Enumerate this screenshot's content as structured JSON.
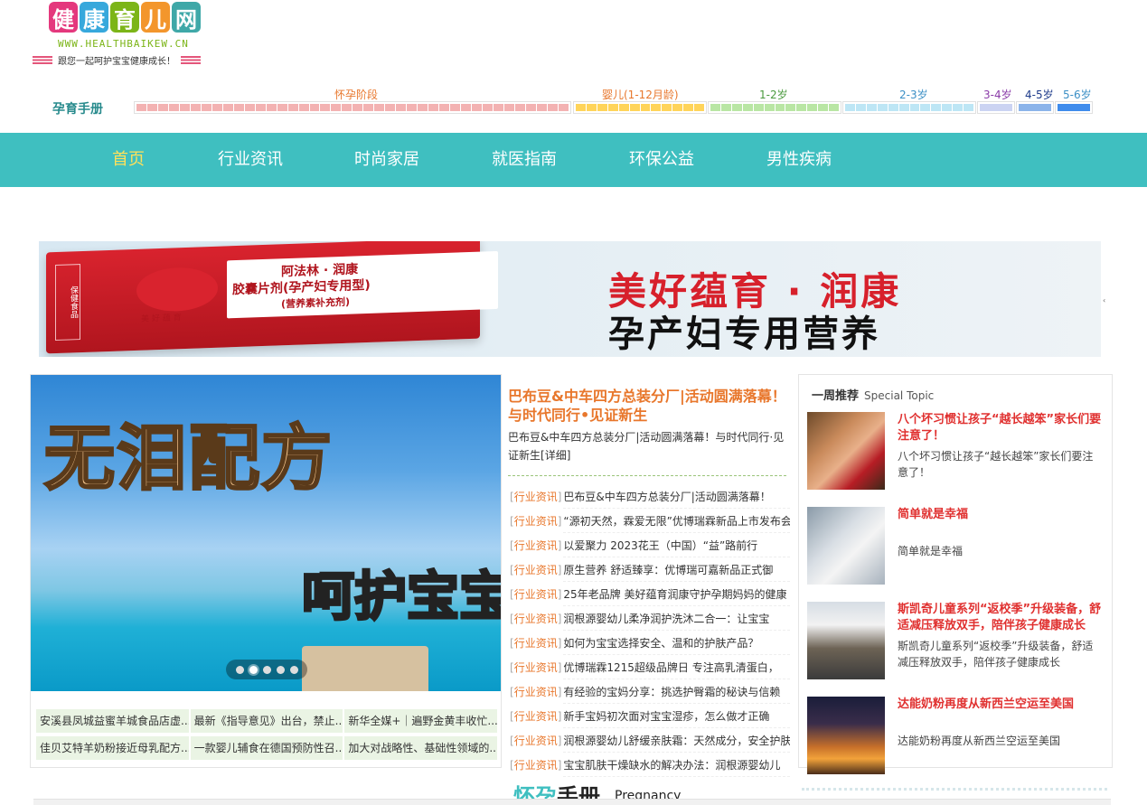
{
  "logo": {
    "chars": [
      "健",
      "康",
      "育",
      "儿",
      "网"
    ],
    "colors": [
      "#e4387d",
      "#37a8dc",
      "#7cb518",
      "#f3962c",
      "#3fa8a8"
    ],
    "url": "WWW.HEALTHBAIKEW.CN",
    "slogan": "跟您一起呵护宝宝健康成长！"
  },
  "pregnancy": {
    "title": "孕育手册",
    "stages": [
      {
        "label": "怀孕阶段",
        "color": "#e8772c",
        "bar": "#f3b2b2",
        "cells": 40
      },
      {
        "label": "婴儿(1-12月龄)",
        "color": "#e8772c",
        "bar": "#ffd45a",
        "cells": 12
      },
      {
        "label": "1-2岁",
        "color": "#4a9a3e",
        "bar": "#b9e6a4",
        "cells": 12
      },
      {
        "label": "2-3岁",
        "color": "#3b8fc5",
        "bar": "#bde6f5",
        "cells": 12
      },
      {
        "label": "3-4岁",
        "color": "#8a3ba8",
        "bar": "#cbd3f2",
        "cells": 1
      },
      {
        "label": "4-5岁",
        "color": "#1d3a8a",
        "bar": "#8cb4ea",
        "cells": 1
      },
      {
        "label": "5-6岁",
        "color": "#3b8fc5",
        "bar": "#3f8cec",
        "cells": 1
      }
    ]
  },
  "nav": {
    "items": [
      "首页",
      "行业资讯",
      "时尚家居",
      "就医指南",
      "环保公益",
      "男性疾病"
    ]
  },
  "banner": {
    "headline": "美好蕴育 · 润康",
    "subline": "孕产妇专用营养",
    "box_brand": "阿法林 · 润康",
    "box_product": "胶囊片剂(孕产妇专用型)",
    "box_note": "(营养素补充剂)",
    "box_small": "美 好 蕴 育",
    "box_side": "保健食品",
    "arrow": "‹"
  },
  "slideshow": {
    "text1": "无泪配方",
    "text2": "呵护宝宝",
    "dots": [
      false,
      true,
      false,
      false,
      false
    ]
  },
  "grid_links": [
    "安溪县凤城益蜜羊城食品店虚...",
    "最新《指导意见》出台，禁止...",
    "新华全媒+｜遍野金黄丰收忙...",
    "佳贝艾特羊奶粉接近母乳配方...",
    "一款婴儿辅食在德国预防性召...",
    "加大对战略性、基础性领域的..."
  ],
  "featured": {
    "title": "巴布豆&中车四方总装分厂|活动圆满落幕！与时代同行•见证新生",
    "desc": "巴布豆&中车四方总装分厂|活动圆满落幕！与时代同行·见证新生",
    "more": "[详细]"
  },
  "news": {
    "tag": "行业资讯",
    "items": [
      "巴布豆&中车四方总装分厂|活动圆满落幕！",
      "“源初天然，霖爱无限”优博瑞霖新品上市发布会",
      "以爱聚力 2023花王（中国）“益”路前行",
      "原生营养 舒适臻享：优博瑞可嘉新品正式御",
      "25年老品牌 美好蕴育润康守护孕期妈妈的健康",
      "润根源婴幼儿柔净润护洗沐二合一：让宝宝",
      "如何为宝宝选择安全、温和的护肤产品？",
      "优博瑞霖1215超级品牌日 专注高乳清蛋白，",
      "有经验的宝妈分享：挑选护臀霜的秘诀与信赖",
      "新手宝妈初次面对宝宝湿疹，怎么做才正确",
      "润根源婴幼儿舒缓亲肤霜：天然成分，安全护肤",
      "宝宝肌肤干燥缺水的解决办法：润根源婴幼儿"
    ]
  },
  "pregnancy_section": {
    "title_a": "怀孕",
    "title_b": "手册",
    "en": "Pregnancy"
  },
  "weekly": {
    "title": "一周推荐",
    "subtitle": "Special Topic",
    "items": [
      {
        "title": "八个坏习惯让孩子“越长越笨”家长们要注意了！",
        "desc": "八个坏习惯让孩子“越长越笨”家长们要注意了！"
      },
      {
        "title": "简单就是幸福",
        "desc": "简单就是幸福"
      },
      {
        "title": "斯凯奇儿童系列“返校季”升级装备，舒适减压释放双手，陪伴孩子健康成长",
        "desc": "斯凯奇儿童系列“返校季”升级装备，舒适减压释放双手，陪伴孩子健康成长"
      },
      {
        "title": "达能奶粉再度从新西兰空运至美国",
        "desc": "达能奶粉再度从新西兰空运至美国"
      }
    ]
  }
}
